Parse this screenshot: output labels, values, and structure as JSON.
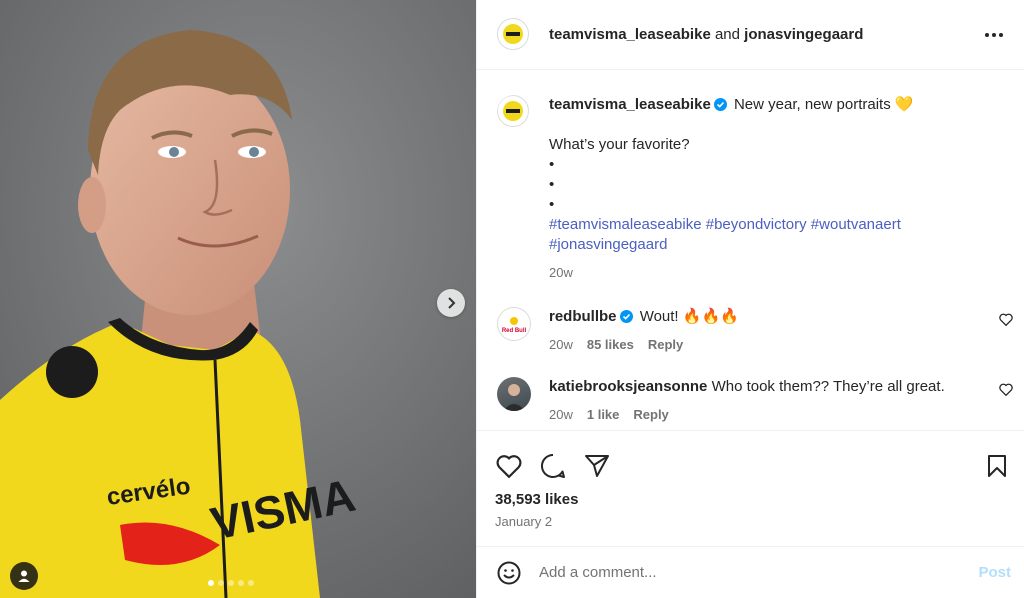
{
  "header": {
    "user1": "teamvisma_leaseabike",
    "and": "and",
    "user2": "jonasvingegaard"
  },
  "caption": {
    "username": "teamvisma_leaseabike",
    "text": "New year, new portraits",
    "emoji": "💛",
    "question": "What’s your favorite?",
    "bullets": [
      "•",
      "•",
      "•"
    ],
    "hashtags_line1": "#teamvismaleaseabike #beyondvictory #woutvanaert",
    "hashtags_line2": "#jonasvingegaard",
    "time": "20w"
  },
  "comments": [
    {
      "username": "redbullbe",
      "text": "Wout! 🔥🔥🔥",
      "time": "20w",
      "likes": "85 likes",
      "reply": "Reply"
    },
    {
      "username": "katiebrooksjeansonne",
      "text": "Who took them?? They’re all great.",
      "time": "20w",
      "likes": "1 like",
      "reply": "Reply"
    }
  ],
  "post": {
    "likes": "38,593 likes",
    "date": "January 2"
  },
  "composer": {
    "placeholder": "Add a comment...",
    "post_label": "Post"
  },
  "brand": {
    "jersey_text": "VISMA",
    "sponsor": "cervélo",
    "redbull_text": "Red Bull"
  },
  "colors": {
    "jersey_yellow": "#f2d81c",
    "link": "#4a5fc1",
    "verified": "#0095f6",
    "post_disabled": "#b2dffc"
  },
  "icons": {
    "next": "chevron-right-icon",
    "tags": "user-tag-icon",
    "more": "more-horizontal-icon",
    "like": "heart-icon",
    "comment": "comment-icon",
    "share": "send-icon",
    "save": "bookmark-icon",
    "emoji": "smiley-icon"
  }
}
